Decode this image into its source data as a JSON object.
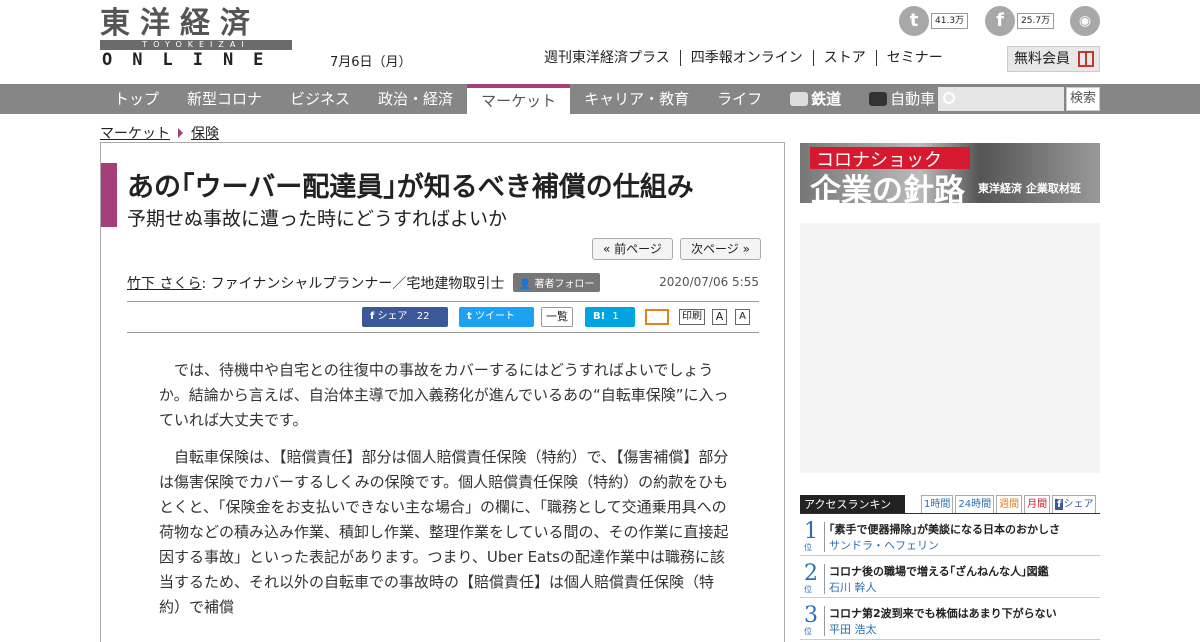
{
  "header": {
    "logo_top": "東洋経済",
    "logo_roman": "TOYOKEIZAI",
    "logo_bottom": "ONLINE",
    "date": "7月6日（月）",
    "links": [
      "週刊東洋経済プラス",
      "四季報オンライン",
      "ストア",
      "セミナー"
    ],
    "member_button": "無料会員",
    "twitter_count": "41.3万",
    "facebook_count": "25.7万"
  },
  "nav": {
    "items": [
      "トップ",
      "新型コロナ",
      "ビジネス",
      "政治・経済",
      "マーケット",
      "キャリア・教育",
      "ライフ",
      "鉄道",
      "自動車"
    ],
    "active": "マーケット",
    "search_button": "検索",
    "search_placeholder": ""
  },
  "breadcrumb": [
    "マーケット",
    "保険"
  ],
  "article": {
    "title": "あの｢ウーバー配達員｣が知るべき補償の仕組み",
    "subtitle": "予期せぬ事故に遭った時にどうすればよいか",
    "prev_page": "« 前ページ",
    "next_page": "次ページ »",
    "author_name": "竹下 さくら",
    "author_role": ": ファイナンシャルプランナー／宅地建物取引士",
    "follow_button": "著者フォロー",
    "published": "2020/07/06 5:55",
    "share": {
      "facebook_label": "シェア",
      "facebook_count": "22",
      "tweet_label": "ツイート",
      "list_label": "一覧",
      "hatena_label": "B!",
      "hatena_count": "1",
      "print_label": "印刷",
      "font_a1": "A",
      "font_a2": "A"
    },
    "paragraphs": [
      "では、待機中や自宅との往復中の事故をカバーするにはどうすればよいでしょうか。結論から言えば、自治体主導で加入義務化が進んでいるあの“自転車保険”に入っていれば大丈夫です。",
      "自転車保険は、【賠償責任】部分は個人賠償責任保険（特約）で、【傷害補償】部分は傷害保険でカバーするしくみの保険です。個人賠償責任保険（特約）の約款をひもとくと、「保険金をお支払いできない主な場合」の欄に、「職務として交通乗用具への荷物などの積み込み作業、積卸し作業、整理作業をしている間の、その作業に直接起因する事故」といった表記があります。つまり、Uber Eatsの配達作業中は職務に該当するため、それ以外の自転車での事故時の【賠償責任】は個人賠償責任保険（特約）で補償"
    ]
  },
  "sidebar": {
    "banner_line1": "コロナショック",
    "banner_line2": "企業の針路",
    "banner_line3": "東洋経済 企業取材班",
    "ranking_label": "アクセスランキング",
    "ranking_tabs": [
      "1時間",
      "24時間",
      "週間",
      "月間",
      "シェア"
    ],
    "ranking": [
      {
        "rank": "1",
        "unit": "位",
        "title": "｢素手で便器掃除｣が美談になる日本のおかしさ",
        "author": "サンドラ・ヘフェリン"
      },
      {
        "rank": "2",
        "unit": "位",
        "title": "コロナ後の職場で増える｢ざんねんな人｣図鑑",
        "author": "石川 幹人"
      },
      {
        "rank": "3",
        "unit": "位",
        "title": "コロナ第2波到来でも株価はあまり下がらない",
        "author": "平田 浩太"
      }
    ]
  },
  "colors": {
    "accent": "#a63e7a",
    "nav_bg": "#868686",
    "facebook": "#3b5998",
    "twitter": "#1da1f2",
    "hatena": "#00a4de",
    "rank_blue": "#2a6fb3"
  }
}
